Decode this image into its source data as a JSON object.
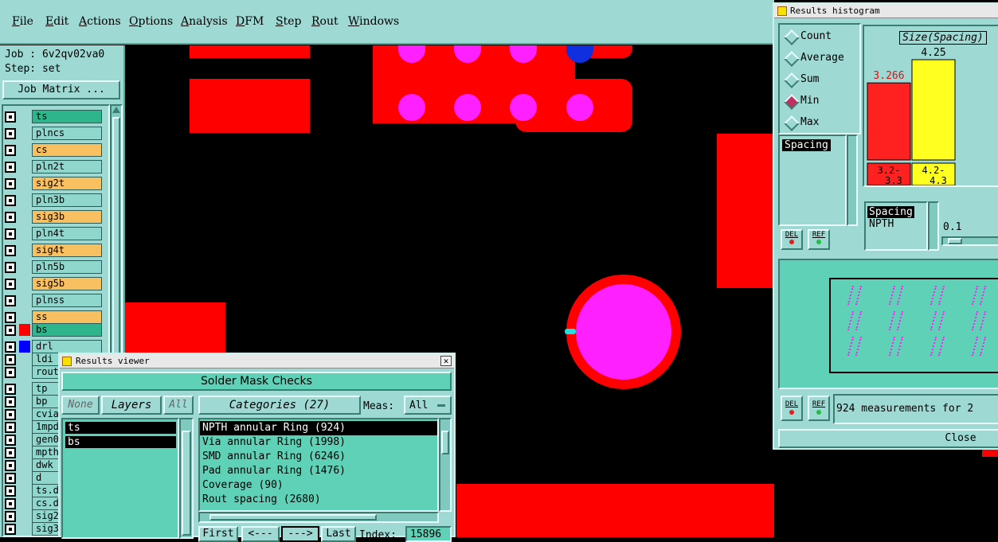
{
  "menubar": {
    "items": [
      "File",
      "Edit",
      "Actions",
      "Options",
      "Analysis",
      "DFM",
      "Step",
      "Rout",
      "Windows"
    ]
  },
  "job": {
    "job_line": "Job : 6v2qv02va0",
    "step_line": "Step: set",
    "matrix_button": "Job Matrix ..."
  },
  "layers": [
    {
      "name": "ts",
      "color": "#2fb58c",
      "marker": ""
    },
    {
      "name": "plncs",
      "color": "#8fd6cc",
      "marker": ""
    },
    {
      "name": "cs",
      "color": "#f8c060",
      "marker": ""
    },
    {
      "name": "pln2t",
      "color": "#8fd6cc",
      "marker": ""
    },
    {
      "name": "sig2t",
      "color": "#f8c060",
      "marker": ""
    },
    {
      "name": "pln3b",
      "color": "#8fd6cc",
      "marker": ""
    },
    {
      "name": "sig3b",
      "color": "#f8c060",
      "marker": ""
    },
    {
      "name": "pln4t",
      "color": "#8fd6cc",
      "marker": ""
    },
    {
      "name": "sig4t",
      "color": "#f8c060",
      "marker": ""
    },
    {
      "name": "pln5b",
      "color": "#8fd6cc",
      "marker": ""
    },
    {
      "name": "sig5b",
      "color": "#f8c060",
      "marker": ""
    },
    {
      "name": "plnss",
      "color": "#8fd6cc",
      "marker": ""
    },
    {
      "name": "ss",
      "color": "#f8c060",
      "marker": ""
    },
    {
      "name": "bs",
      "color": "#2fb58c",
      "marker": "#ff0000"
    },
    {
      "name": "drl",
      "color": "#8fd6cc",
      "marker": "#0000ff"
    },
    {
      "name": "ldi",
      "color": "#8fd6cc",
      "marker": ""
    },
    {
      "name": "rout",
      "color": "#8fd6cc",
      "marker": ""
    },
    {
      "name": "tp",
      "color": "#8fd6cc",
      "marker": ""
    },
    {
      "name": "bp",
      "color": "#8fd6cc",
      "marker": ""
    },
    {
      "name": "cvia",
      "color": "#8fd6cc",
      "marker": ""
    },
    {
      "name": "1mpd",
      "color": "#8fd6cc",
      "marker": ""
    },
    {
      "name": "gen0",
      "color": "#8fd6cc",
      "marker": ""
    },
    {
      "name": "mpth",
      "color": "#8fd6cc",
      "marker": ""
    },
    {
      "name": "dwk",
      "color": "#8fd6cc",
      "marker": ""
    },
    {
      "name": "d",
      "color": "#8fd6cc",
      "marker": ""
    },
    {
      "name": "ts.d",
      "color": "#8fd6cc",
      "marker": ""
    },
    {
      "name": "cs.d",
      "color": "#8fd6cc",
      "marker": ""
    },
    {
      "name": "sig2",
      "color": "#8fd6cc",
      "marker": ""
    },
    {
      "name": "sig3",
      "color": "#8fd6cc",
      "marker": ""
    }
  ],
  "results_viewer": {
    "title": "Results viewer",
    "header": "Solder Mask Checks",
    "none_btn": "None",
    "layers_btn": "Layers",
    "all_btn": "All",
    "categories_btn": "Categories (27)",
    "meas_label": "Meas:",
    "meas_value": "All",
    "layer_list": [
      "ts",
      "bs"
    ],
    "categories": [
      "NPTH annular Ring (924)",
      "Via annular Ring (1998)",
      "SMD annular Ring (6246)",
      "Pad annular Ring (1476)",
      "Coverage (90)",
      "Rout spacing (2680)"
    ],
    "nav": {
      "first": "First",
      "prev": "<---",
      "next": "--->",
      "last": "Last",
      "index_label": "Index:",
      "index_value": "15896"
    }
  },
  "histogram": {
    "title": "Results histogram",
    "options": [
      "Count",
      "Average",
      "Sum",
      "Min",
      "Max"
    ],
    "selected_option": "Min",
    "measure_list": [
      "Spacing"
    ],
    "chart_title": "Size(Spacing)",
    "filter_list": [
      "Spacing",
      "NPTH"
    ],
    "slider_value": "0.1",
    "del_label": "DEL",
    "ref_label": "REF",
    "status": "924 measurements for 2",
    "close_label": "Close"
  },
  "chart_data": {
    "type": "bar",
    "title": "Size(Spacing)",
    "categories": [
      "3.2-3.3",
      "4.2-4.3"
    ],
    "values": [
      3.266,
      4.25
    ],
    "colors": [
      "#ff2020",
      "#ffff20"
    ]
  }
}
